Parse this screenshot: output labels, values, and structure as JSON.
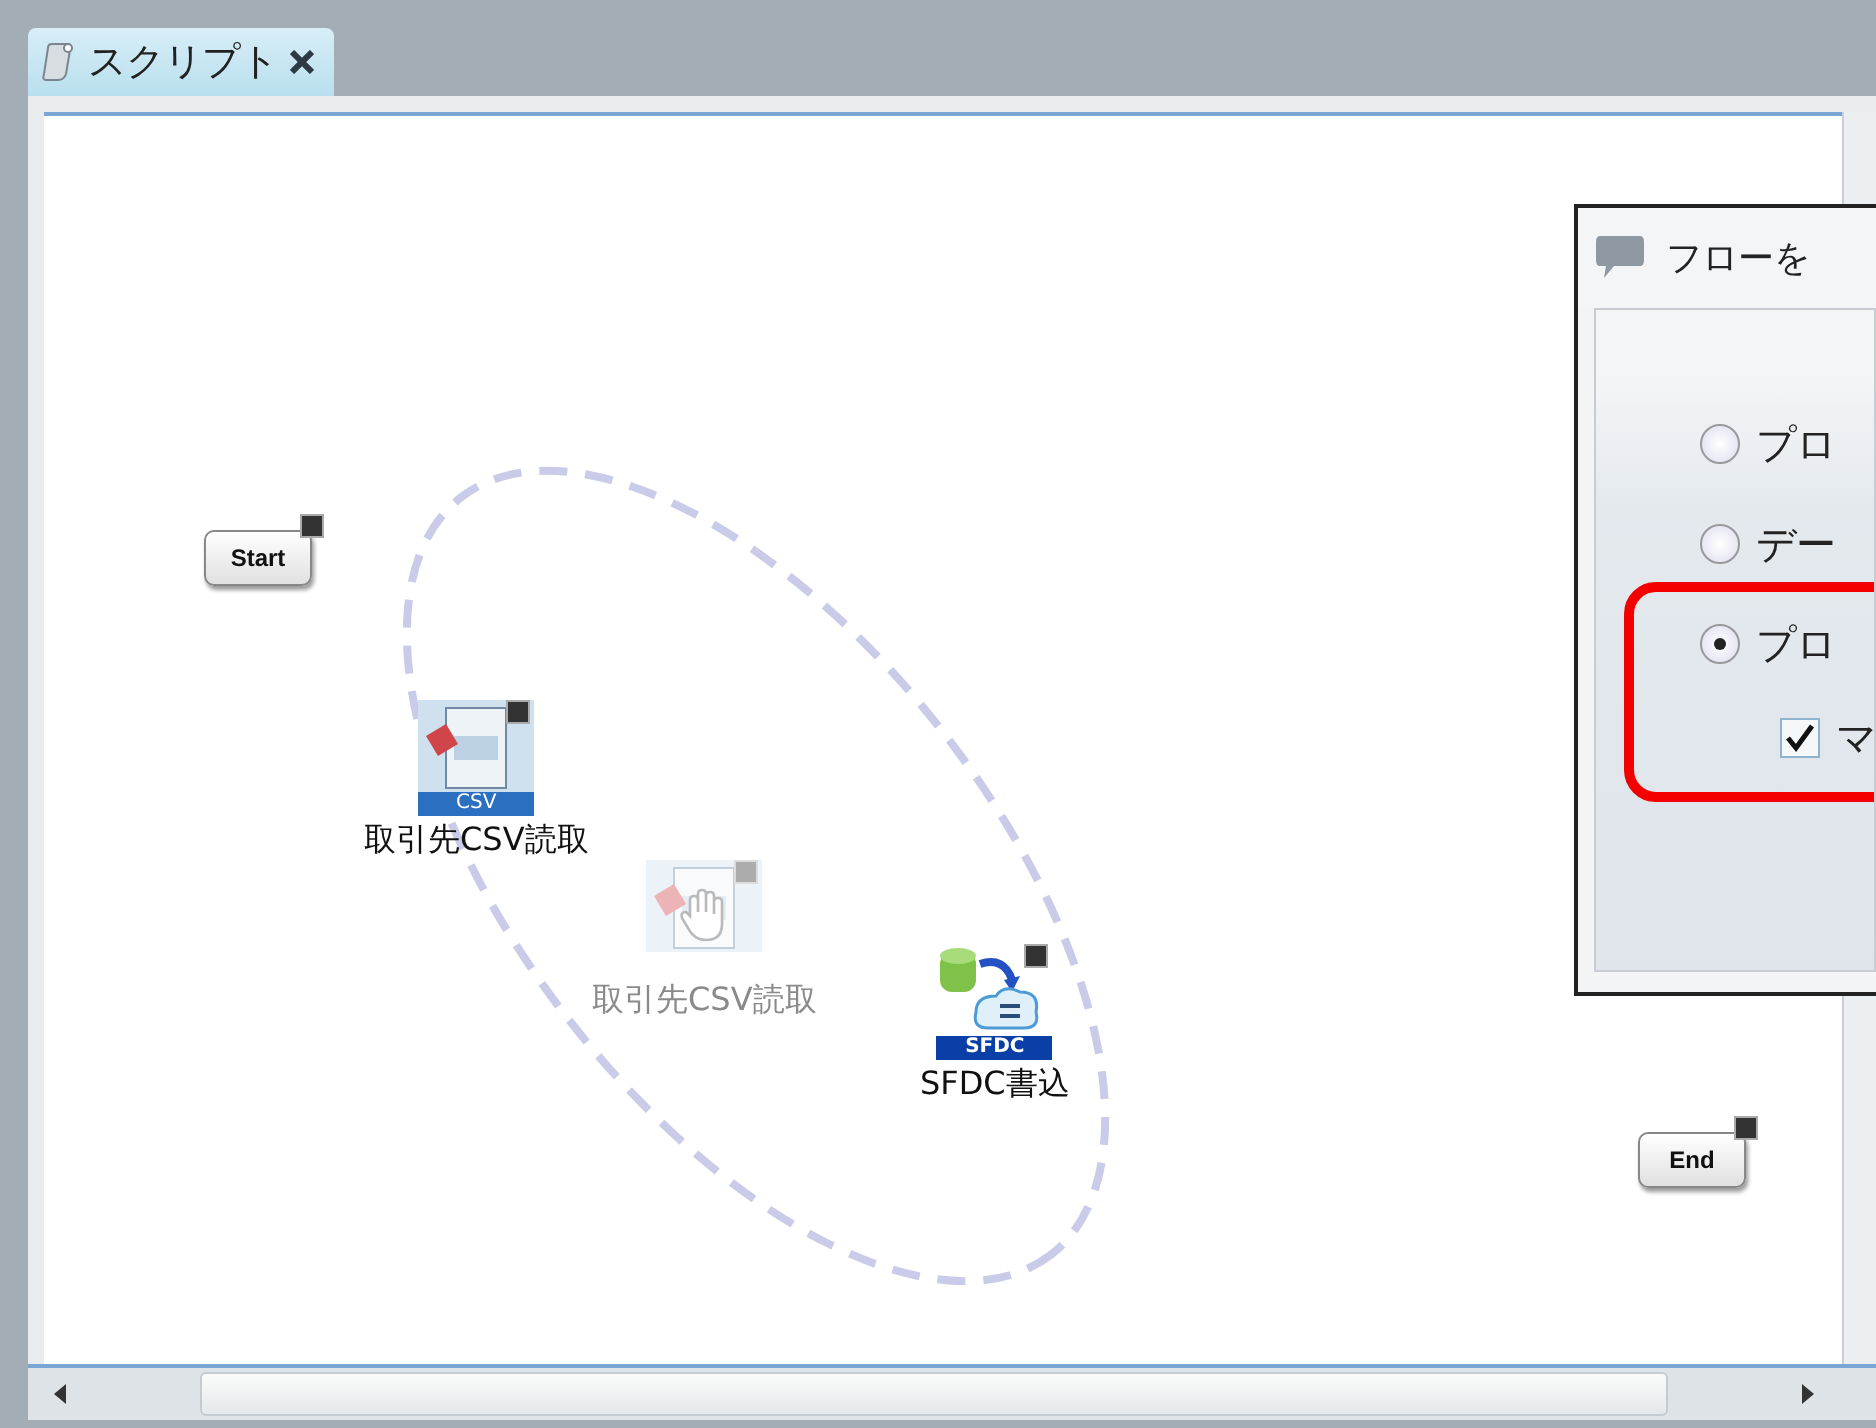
{
  "tab": {
    "label": "スクリプト",
    "selected": true
  },
  "nodes": [
    {
      "kind": "terminal",
      "label": "Start",
      "dragging": false
    },
    {
      "kind": "csv",
      "label": "取引先CSV読取",
      "badge": "CSV",
      "dragging": false
    },
    {
      "kind": "csv",
      "label": "取引先CSV読取",
      "dragging": true
    },
    {
      "kind": "sfdc",
      "label": "SFDC書込",
      "badge": "SFDC",
      "dragging": false
    },
    {
      "kind": "terminal",
      "label": "End",
      "dragging": false
    }
  ],
  "dialog": {
    "title": "フローを",
    "options": [
      {
        "kind": "radio",
        "label": "プロ",
        "selected": false
      },
      {
        "kind": "radio",
        "label": "デー",
        "selected": false
      },
      {
        "kind": "radio",
        "label": "プロ",
        "selected": true
      },
      {
        "kind": "checkbox",
        "label": "マ",
        "checked": true
      }
    ]
  }
}
